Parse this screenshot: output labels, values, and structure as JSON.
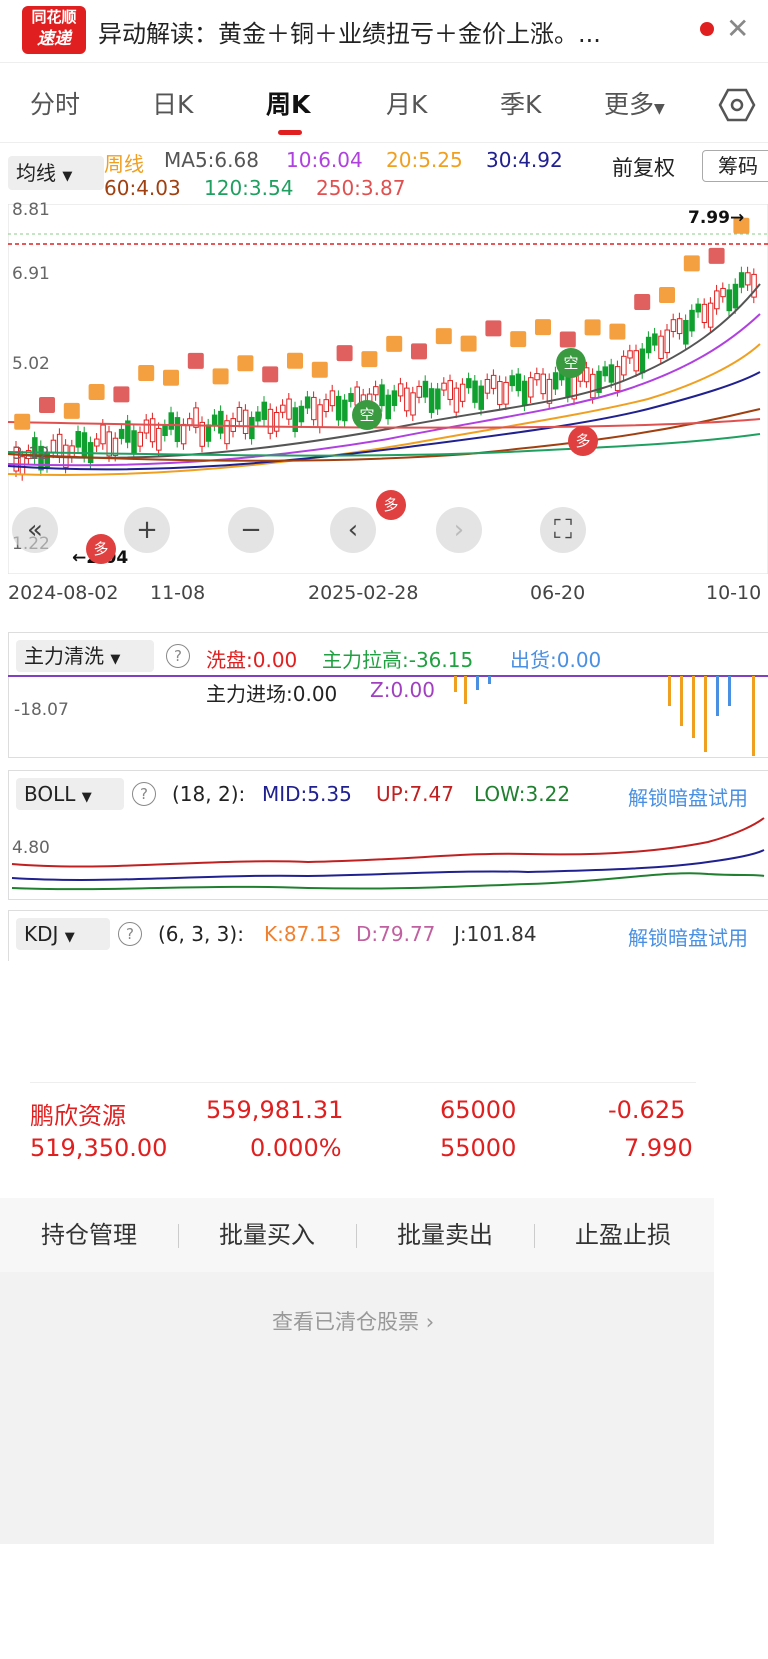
{
  "notice": {
    "logo_line1": "同花顺",
    "logo_line2": "速递",
    "title": "异动解读：黄金＋铜＋业绩扭亏＋金价上涨。..."
  },
  "tabs": [
    "分时",
    "日K",
    "周K",
    "月K",
    "季K",
    "更多"
  ],
  "active_tab": "周K",
  "ma_bar": {
    "selector": "均线",
    "period": "周线",
    "items": [
      {
        "text": "MA5:6.68",
        "color": "#555555"
      },
      {
        "text": "10:6.04",
        "color": "#b040e0"
      },
      {
        "text": "20:5.25",
        "color": "#f0a020"
      },
      {
        "text": "30:4.92",
        "color": "#202090"
      },
      {
        "text": "60:4.03",
        "color": "#a04010"
      },
      {
        "text": "120:3.54",
        "color": "#20a060"
      },
      {
        "text": "250:3.87",
        "color": "#e05050"
      }
    ],
    "adjust": "前复权",
    "chips": "筹码"
  },
  "kline": {
    "y_labels": [
      "8.81",
      "6.91",
      "5.02",
      "3.12",
      "1.22"
    ],
    "high_label": "7.99",
    "low_label": "2.04",
    "markers": [
      "多",
      "多",
      "空",
      "空",
      "多"
    ],
    "dates": [
      "2024-08-02",
      "11-08",
      "2025-02-28",
      "06-20",
      "10-10"
    ]
  },
  "controls": [
    "«",
    "+",
    "−",
    "‹",
    "›",
    "⛶"
  ],
  "main_force": {
    "selector": "主力清洗",
    "wash": "洗盘:0.00",
    "pull": "主力拉高:-36.15",
    "ship": "出货:0.00",
    "enter": "主力进场:0.00",
    "z": "Z:0.00",
    "y_label": "-18.07"
  },
  "boll": {
    "selector": "BOLL",
    "params": "(18, 2):",
    "mid": "MID:5.35",
    "up": "UP:7.47",
    "low": "LOW:3.22",
    "unlock": "解锁暗盘试用",
    "y_label": "4.80"
  },
  "kdj": {
    "selector": "KDJ",
    "params": "(6, 3, 3):",
    "k": "K:87.13",
    "d": "D:79.77",
    "j": "J:101.84",
    "unlock": "解锁暗盘试用"
  },
  "position": {
    "row1": [
      "鹏欣资源",
      "559,981.31",
      "65000",
      "-0.625"
    ],
    "row2": [
      "519,350.00",
      "0.000%",
      "55000",
      "7.990"
    ]
  },
  "actions": [
    "持仓管理",
    "批量买入",
    "批量卖出",
    "止盈止损"
  ],
  "cleared_link": "查看已清仓股票"
}
